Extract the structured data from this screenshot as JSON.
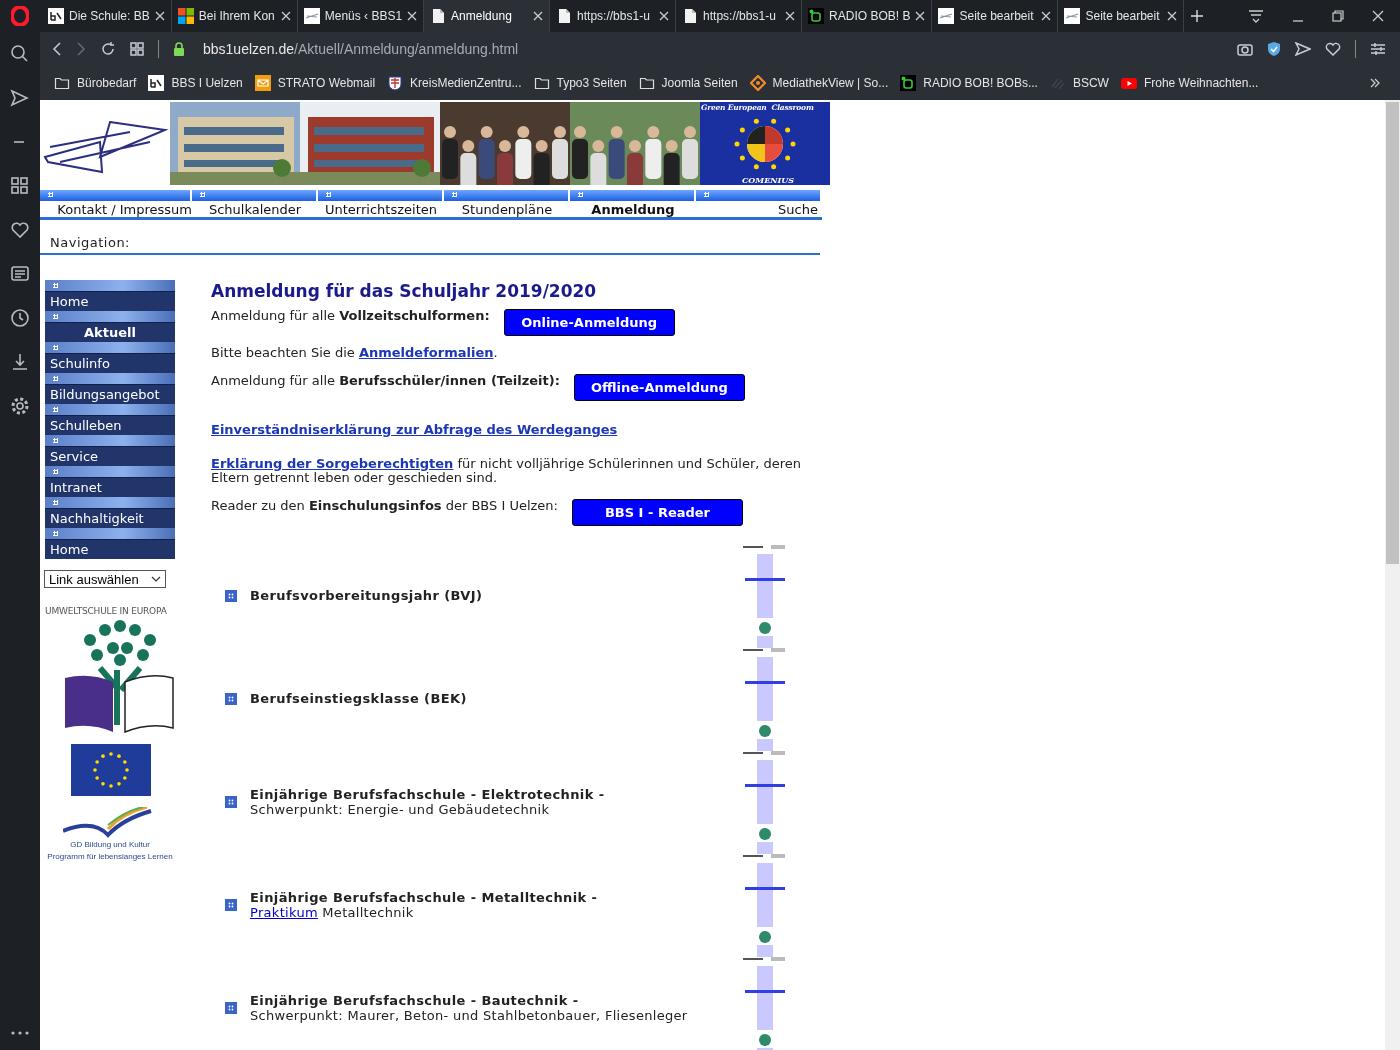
{
  "browser": {
    "tabs": [
      {
        "title": "Die Schule: BB",
        "kind": "bbs",
        "selected": false
      },
      {
        "title": "Bei Ihrem Kon",
        "kind": "windows",
        "selected": false
      },
      {
        "title": "Menüs ‹ BBS1",
        "kind": "logo",
        "selected": false
      },
      {
        "title": "Anmeldung",
        "kind": "page",
        "selected": true
      },
      {
        "title": "https://bbs1-u",
        "kind": "page",
        "selected": false
      },
      {
        "title": "https://bbs1-u",
        "kind": "page",
        "selected": false
      },
      {
        "title": "RADIO BOB! B",
        "kind": "radio",
        "selected": false
      },
      {
        "title": "Seite bearbeit",
        "kind": "logo",
        "selected": false
      },
      {
        "title": "Seite bearbeit",
        "kind": "logo",
        "selected": false
      }
    ],
    "address": {
      "domain": "bbs1uelzen.de",
      "path": "/Aktuell/Anmeldung/anmeldung.html"
    },
    "bookmarks": [
      {
        "label": "Bürobedarf",
        "kind": "folder"
      },
      {
        "label": "BBS I Uelzen",
        "kind": "bbs"
      },
      {
        "label": "STRATO Webmail",
        "kind": "mail"
      },
      {
        "label": "KreisMedienZentru...",
        "kind": "crest"
      },
      {
        "label": "Typo3 Seiten",
        "kind": "folder"
      },
      {
        "label": "Joomla Seiten",
        "kind": "folder"
      },
      {
        "label": "MediathekView | So...",
        "kind": "diamond"
      },
      {
        "label": "RADIO BOB! BOBs...",
        "kind": "radio"
      },
      {
        "label": "BSCW",
        "kind": "faint"
      },
      {
        "label": "Frohe Weihnachten...",
        "kind": "video"
      }
    ]
  },
  "page": {
    "header": {
      "badge_title": "Green European  Classroom",
      "badge_caption": "COMENIUS"
    },
    "nav_tabs": [
      {
        "label": "Kontakt / Impressum",
        "selected": false
      },
      {
        "label": "Schulkalender",
        "selected": false
      },
      {
        "label": "Unterrichtszeiten",
        "selected": false
      },
      {
        "label": "Stundenpläne",
        "selected": false
      },
      {
        "label": "Anmeldung",
        "selected": true
      },
      {
        "label": "Suche",
        "selected": false
      }
    ],
    "navigation_label": "Navigation:",
    "menu": [
      {
        "label": "Home",
        "selected": false
      },
      {
        "label": "Aktuell",
        "selected": true
      },
      {
        "label": "Schulinfo",
        "selected": false
      },
      {
        "label": "Bildungsangebot",
        "selected": false
      },
      {
        "label": "Schulleben",
        "selected": false
      },
      {
        "label": "Service",
        "selected": false
      },
      {
        "label": "Intranet",
        "selected": false
      },
      {
        "label": "Nachhaltigkeit",
        "selected": false
      },
      {
        "label": "Home",
        "selected": false
      }
    ],
    "link_select": {
      "value": "Link auswählen"
    },
    "eco_logo": {
      "arc_text": "UMWELTSCHULE IN EUROPA"
    },
    "eu_logo": {
      "lines": [
        "GD Bildung und Kultur",
        "Programm für lebenslanges Lernen"
      ]
    },
    "content": {
      "title": "Anmeldung für das Schuljahr 2019/2020",
      "blocks": [
        {
          "kind": "button_row",
          "text": "Anmeldung für alle **Vollzeitschulformen:**",
          "button": "Online-Anmeldung"
        },
        {
          "kind": "link_sentence",
          "before": "Bitte beachten Sie die ",
          "link": "Anmeldeformalien",
          "after": "."
        },
        {
          "kind": "button_row",
          "text": "Anmeldung für alle **Berufsschüler/innen (Teilzeit):**",
          "button": "Offline-Anmeldung"
        },
        {
          "kind": "link",
          "link": "Einverständniserklärung zur Abfrage des Werdeganges"
        },
        {
          "kind": "link_sentence",
          "link": "Erklärung der Sorgeberechtigten",
          "after": " für nicht volljährige Schülerinnen und Schüler, deren Eltern getrennt leben oder geschieden sind."
        },
        {
          "kind": "button_row",
          "text": "Reader zu den **Einschulungsinfos** der BBS I Uelzen:",
          "button": "BBS I - Reader"
        }
      ],
      "courses": [
        {
          "title": "Berufsvorbereitungsjahr (BVJ)"
        },
        {
          "title": "Berufseinstiegsklasse (BEK)"
        },
        {
          "title": "Einjährige Berufsfachschule - Elektrotechnik -",
          "subtitle": "Schwerpunkt: Energie- und Gebäudetechnik"
        },
        {
          "title": "Einjährige Berufsfachschule - Metalltechnik -",
          "subtitle_link": "Praktikum",
          "subtitle": " Metalltechnik"
        },
        {
          "title": "Einjährige Berufsfachschule - Bautechnik -",
          "subtitle": "Schwerpunkt: Maurer, Beton- und Stahlbetonbauer, Fliesenleger"
        }
      ]
    }
  }
}
